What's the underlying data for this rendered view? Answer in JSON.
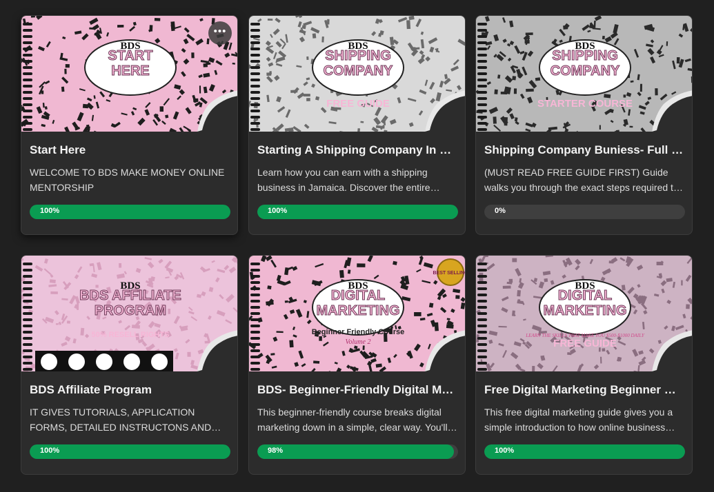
{
  "colors": {
    "page_bg": "#202020",
    "card_bg": "#2c2c2c",
    "progress_fill": "#0a9c52",
    "progress_track": "#3f3f3f",
    "pink": "#f3b9d6"
  },
  "courses": [
    {
      "title": "Start Here",
      "description": "WELCOME TO BDS MAKE MONEY ONLINE MENTORSHIP",
      "progress_label": "100%",
      "progress": 100,
      "thumbnail": {
        "brand": "BDS",
        "lines": [
          "START",
          "HERE"
        ],
        "subtitle": "",
        "theme": "pink"
      },
      "more_icon": "ellipsis-icon",
      "more_label": "•••"
    },
    {
      "title": "Starting A Shipping Company In Jamaica",
      "description": "Learn how you can earn with a shipping business in Jamaica. Discover the entire process step by step.",
      "progress_label": "100%",
      "progress": 100,
      "thumbnail": {
        "brand": "BDS",
        "lines": [
          "SHIPPING",
          "COMPANY"
        ],
        "subtitle": "FREE GUIDE",
        "theme": "gray"
      }
    },
    {
      "title": "Shipping Company Buniess- Full Course",
      "description": "(MUST READ FREE GUIDE FIRST) Guide walks you through the exact steps required to start.",
      "progress_label": "0%",
      "progress": 0,
      "thumbnail": {
        "brand": "BDS",
        "lines": [
          "SHIPPING",
          "COMPANY"
        ],
        "subtitle": "STARTER COURSE",
        "theme": "dark"
      }
    },
    {
      "title": "BDS Affiliate Program",
      "description": "IT GIVES TUTORIALS, APPLICATION FORMS, DETAILED INSTRUCTONS AND MORE.",
      "progress_label": "100%",
      "progress": 100,
      "thumbnail": {
        "brand": "BDS",
        "lines": [
          "BDS AFFILIATE",
          "PROGRAM"
        ],
        "subtitle": "50% RESELL RIGHTS",
        "theme": "lightpink"
      }
    },
    {
      "title": "BDS- Beginner-Friendly Digital Marketing",
      "description": "This beginner-friendly course breaks digital marketing down in a simple, clear way. You'll learn the basics.",
      "progress_label": "98%",
      "progress": 98,
      "thumbnail": {
        "brand": "BDS",
        "lines": [
          "DIGITAL",
          "MARKETING"
        ],
        "subtitle": "Beginner Friendly Course",
        "extra": "Volume 2",
        "badge": "BEST SELLING",
        "theme": "pink"
      }
    },
    {
      "title": "Free Digital Marketing Beginner Guide",
      "description": "This free digital marketing guide gives you a simple introduction to how online business works.",
      "progress_label": "100%",
      "progress": 100,
      "thumbnail": {
        "brand": "BDS",
        "lines": [
          "DIGITAL",
          "MARKETING"
        ],
        "subtitle": "FREE GUIDE",
        "extra": "LEARN THE SKILLS THAT MAKE YOU $500-$1000 DAILY",
        "theme": "mauve"
      }
    }
  ]
}
